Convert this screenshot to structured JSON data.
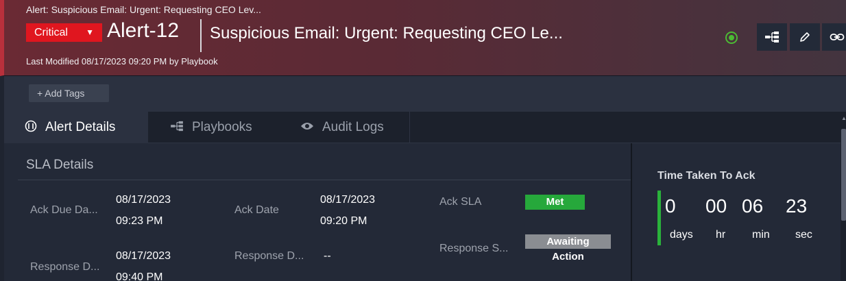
{
  "header": {
    "breadcrumb": "Alert: Suspicious Email: Urgent: Requesting CEO Lev...",
    "severity": "Critical",
    "alert_id": "Alert-12",
    "title": "Suspicious Email: Urgent: Requesting CEO Le...",
    "last_modified": "Last Modified 08/17/2023 09:20 PM by Playbook",
    "status_color": "#4cbb34",
    "buttons": [
      {
        "icon": "playbook-tree-icon"
      },
      {
        "icon": "pencil-icon"
      },
      {
        "icon": "link-icon"
      }
    ]
  },
  "tags": {
    "add_label": "+ Add Tags"
  },
  "tabs": [
    {
      "label": "Alert Details",
      "icon": "alert-icon",
      "active": true
    },
    {
      "label": "Playbooks",
      "icon": "playbook-tree-icon",
      "active": false
    },
    {
      "label": "Audit Logs",
      "icon": "eye-icon",
      "active": false
    }
  ],
  "sla": {
    "title": "SLA Details",
    "ack_due_label": "Ack Due Da...",
    "ack_due_date": "08/17/2023",
    "ack_due_time": "09:23 PM",
    "ack_date_label": "Ack Date",
    "ack_date_date": "08/17/2023",
    "ack_date_time": "09:20 PM",
    "ack_sla_label": "Ack SLA",
    "ack_sla_status": "Met",
    "response_due_label": "Response D...",
    "response_due_date": "08/17/2023",
    "response_due_time": "09:40 PM",
    "response_date_label": "Response D...",
    "response_date_value": "--",
    "response_sla_label": "Response S...",
    "response_sla_status_1": "Awaiting",
    "response_sla_status_2": "Action"
  },
  "time_to_ack": {
    "title": "Time Taken To Ack",
    "days": "0",
    "hr": "00",
    "min": "06",
    "sec": "23",
    "days_label": "days",
    "hr_label": "hr",
    "min_label": "min",
    "sec_label": "sec"
  },
  "colors": {
    "critical": "#e0161f",
    "met": "#26a83b",
    "awaiting": "#8a8d92",
    "accent_green": "#2ab23b"
  }
}
